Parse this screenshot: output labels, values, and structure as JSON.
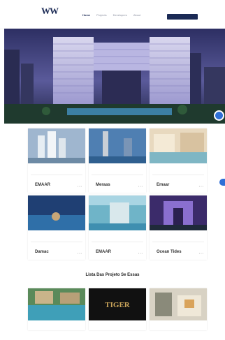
{
  "header": {
    "logo_mark": "WW",
    "logo_text": "",
    "nav": [
      {
        "label": "Home",
        "active": true
      },
      {
        "label": "Projects",
        "active": false
      },
      {
        "label": "Developers",
        "active": false
      },
      {
        "label": "About",
        "active": false
      }
    ],
    "cta_label": ""
  },
  "projects": [
    {
      "title": "",
      "subtitle": "",
      "developer": "EMAAR"
    },
    {
      "title": "",
      "subtitle": "",
      "developer": "Meraas"
    },
    {
      "title": "",
      "subtitle": "",
      "developer": "Emaar"
    },
    {
      "title": "",
      "subtitle": "",
      "developer": "Damac"
    },
    {
      "title": "",
      "subtitle": "",
      "developer": "EMAAR"
    },
    {
      "title": "",
      "subtitle": "",
      "developer": "Ocean Tides"
    }
  ],
  "section2": {
    "title": "Lista Das Projeto Se Essas",
    "filters": [
      {
        "label": "",
        "active": false
      },
      {
        "label": "",
        "active": false
      },
      {
        "label": "",
        "active": true
      }
    ],
    "cards": [
      {
        "title": "",
        "subtitle": ""
      },
      {
        "title": "",
        "subtitle": "",
        "badge": "TIGER"
      },
      {
        "title": "",
        "subtitle": ""
      }
    ]
  },
  "colors": {
    "brand": "#1b2a55",
    "accent": "#2f6fd6"
  }
}
